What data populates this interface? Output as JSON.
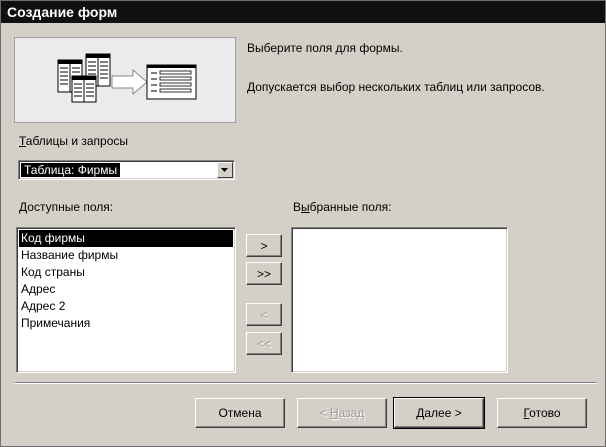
{
  "window": {
    "title": "Создание форм"
  },
  "description": {
    "line1": "Выберите поля для формы.",
    "line2": "Допускается выбор нескольких таблиц или запросов."
  },
  "tables": {
    "label_accel": "Т",
    "label_rest": "аблицы и запросы",
    "selected_value": "Таблица: Фирмы"
  },
  "available": {
    "label_accel": "Д",
    "label_rest": "оступные поля:",
    "items": [
      "Код фирмы",
      "Название фирмы",
      "Код страны",
      "Адрес",
      "Адрес 2",
      "Примечания"
    ],
    "selected_index": 0
  },
  "selected": {
    "label_pre": "В",
    "label_accel": "ы",
    "label_rest": "бранные поля:",
    "items": []
  },
  "move_buttons": {
    "add": ">",
    "add_all": ">>",
    "remove": "<",
    "remove_all": "<<"
  },
  "footer": {
    "cancel": "Отмена",
    "back_pre": "< ",
    "back_accel": "Н",
    "back_rest": "азад",
    "next_accel": "Д",
    "next_rest": "алее >",
    "finish_accel": "Г",
    "finish_rest": "отово"
  },
  "icons": {
    "combo": "chevron-down-icon",
    "picture": "tables-to-form-illustration"
  }
}
